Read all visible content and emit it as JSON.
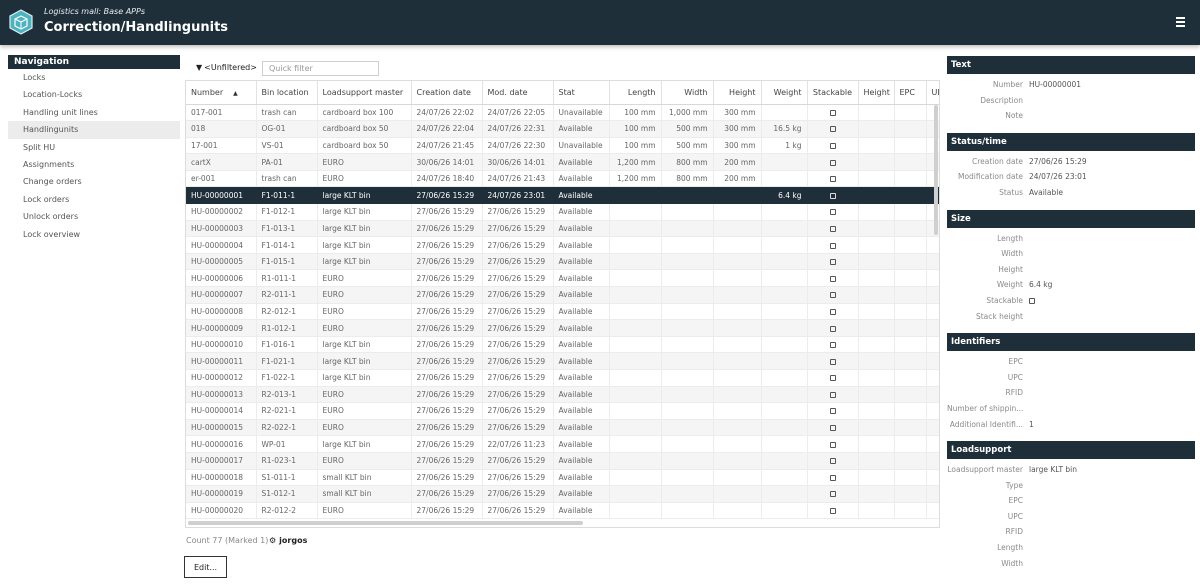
{
  "header": {
    "subtitle": "Logistics mall: Base APPs",
    "title": "Correction/Handlingunits"
  },
  "navigation": {
    "title": "Navigation",
    "items": [
      {
        "label": "Locks"
      },
      {
        "label": "Location-Locks"
      },
      {
        "label": "Handling unit lines"
      },
      {
        "label": "Handlingunits"
      },
      {
        "label": "Split HU"
      },
      {
        "label": "Assignments"
      },
      {
        "label": "Change orders"
      },
      {
        "label": "Lock orders"
      },
      {
        "label": "Unlock orders"
      },
      {
        "label": "Lock overview"
      }
    ],
    "active_index": 3
  },
  "toolbar": {
    "filter_label": "<Unfiltered>",
    "quick_filter_placeholder": "Quick filter",
    "quick_filter_value": ""
  },
  "grid": {
    "columns": [
      "Number",
      "Bin location",
      "Loadsupport master",
      "Creation date",
      "Mod. date",
      "Stat",
      "Length",
      "Width",
      "Height",
      "Weight",
      "Stackable",
      "Height",
      "EPC",
      "UPC"
    ],
    "selected_row": 5,
    "rows": [
      [
        "017-001",
        "trash can",
        "cardboard box 100",
        "24/07/26 22:02",
        "24/07/26 22:05",
        "Unavailable",
        "100 mm",
        "1,000 mm",
        "300 mm",
        ""
      ],
      [
        "018",
        "OG-01",
        "cardboard box 50",
        "24/07/26 22:04",
        "24/07/26 22:31",
        "Available",
        "100 mm",
        "500 mm",
        "300 mm",
        "16.5 kg"
      ],
      [
        "17-001",
        "VS-01",
        "cardboard box 50",
        "24/07/26 21:45",
        "24/07/26 22:30",
        "Unavailable",
        "100 mm",
        "500 mm",
        "300 mm",
        "1 kg"
      ],
      [
        "cartX",
        "PA-01",
        "EURO",
        "30/06/26 14:01",
        "30/06/26 14:01",
        "Available",
        "1,200 mm",
        "800 mm",
        "200 mm",
        ""
      ],
      [
        "er-001",
        "trash can",
        "EURO",
        "24/07/26 18:40",
        "24/07/26 21:43",
        "Available",
        "1,200 mm",
        "800 mm",
        "200 mm",
        ""
      ],
      [
        "HU-00000001",
        "F1-011-1",
        "large KLT bin",
        "27/06/26 15:29",
        "24/07/26 23:01",
        "Available",
        "",
        "",
        "",
        "6.4 kg"
      ],
      [
        "HU-00000002",
        "F1-012-1",
        "large KLT bin",
        "27/06/26 15:29",
        "27/06/26 15:29",
        "Available",
        "",
        "",
        "",
        ""
      ],
      [
        "HU-00000003",
        "F1-013-1",
        "large KLT bin",
        "27/06/26 15:29",
        "27/06/26 15:29",
        "Available",
        "",
        "",
        "",
        ""
      ],
      [
        "HU-00000004",
        "F1-014-1",
        "large KLT bin",
        "27/06/26 15:29",
        "27/06/26 15:29",
        "Available",
        "",
        "",
        "",
        ""
      ],
      [
        "HU-00000005",
        "F1-015-1",
        "large KLT bin",
        "27/06/26 15:29",
        "27/06/26 15:29",
        "Available",
        "",
        "",
        "",
        ""
      ],
      [
        "HU-00000006",
        "R1-011-1",
        "EURO",
        "27/06/26 15:29",
        "27/06/26 15:29",
        "Available",
        "",
        "",
        "",
        ""
      ],
      [
        "HU-00000007",
        "R2-011-1",
        "EURO",
        "27/06/26 15:29",
        "27/06/26 15:29",
        "Available",
        "",
        "",
        "",
        ""
      ],
      [
        "HU-00000008",
        "R2-012-1",
        "EURO",
        "27/06/26 15:29",
        "27/06/26 15:29",
        "Available",
        "",
        "",
        "",
        ""
      ],
      [
        "HU-00000009",
        "R1-012-1",
        "EURO",
        "27/06/26 15:29",
        "27/06/26 15:29",
        "Available",
        "",
        "",
        "",
        ""
      ],
      [
        "HU-00000010",
        "F1-016-1",
        "large KLT bin",
        "27/06/26 15:29",
        "27/06/26 15:29",
        "Available",
        "",
        "",
        "",
        ""
      ],
      [
        "HU-00000011",
        "F1-021-1",
        "large KLT bin",
        "27/06/26 15:29",
        "27/06/26 15:29",
        "Available",
        "",
        "",
        "",
        ""
      ],
      [
        "HU-00000012",
        "F1-022-1",
        "large KLT bin",
        "27/06/26 15:29",
        "27/06/26 15:29",
        "Available",
        "",
        "",
        "",
        ""
      ],
      [
        "HU-00000013",
        "R2-013-1",
        "EURO",
        "27/06/26 15:29",
        "27/06/26 15:29",
        "Available",
        "",
        "",
        "",
        ""
      ],
      [
        "HU-00000014",
        "R2-021-1",
        "EURO",
        "27/06/26 15:29",
        "27/06/26 15:29",
        "Available",
        "",
        "",
        "",
        ""
      ],
      [
        "HU-00000015",
        "R2-022-1",
        "EURO",
        "27/06/26 15:29",
        "27/06/26 15:29",
        "Available",
        "",
        "",
        "",
        ""
      ],
      [
        "HU-00000016",
        "WP-01",
        "large KLT bin",
        "27/06/26 15:29",
        "22/07/26 11:23",
        "Available",
        "",
        "",
        "",
        ""
      ],
      [
        "HU-00000017",
        "R1-023-1",
        "EURO",
        "27/06/26 15:29",
        "27/06/26 15:29",
        "Available",
        "",
        "",
        "",
        ""
      ],
      [
        "HU-00000018",
        "S1-011-1",
        "small KLT bin",
        "27/06/26 15:29",
        "27/06/26 15:29",
        "Available",
        "",
        "",
        "",
        ""
      ],
      [
        "HU-00000019",
        "S1-012-1",
        "small KLT bin",
        "27/06/26 15:29",
        "27/06/26 15:29",
        "Available",
        "",
        "",
        "",
        ""
      ],
      [
        "HU-00000020",
        "R2-012-2",
        "EURO",
        "27/06/26 15:29",
        "27/06/26 15:29",
        "Available",
        "",
        "",
        "",
        ""
      ]
    ]
  },
  "footer": {
    "count": "Count 77 (Marked 1)",
    "user": "jorgos",
    "edit_label": "Edit..."
  },
  "detail": {
    "sections": [
      {
        "title": "Text",
        "fields": [
          {
            "label": "Number",
            "value": "HU-00000001"
          },
          {
            "label": "Description",
            "value": ""
          },
          {
            "label": "Note",
            "value": ""
          }
        ]
      },
      {
        "title": "Status/time",
        "fields": [
          {
            "label": "Creation date",
            "value": "27/06/26 15:29"
          },
          {
            "label": "Modification date",
            "value": "24/07/26 23:01"
          },
          {
            "label": "Status",
            "value": "Available"
          }
        ]
      },
      {
        "title": "Size",
        "fields": [
          {
            "label": "Length",
            "value": ""
          },
          {
            "label": "Width",
            "value": ""
          },
          {
            "label": "Height",
            "value": ""
          },
          {
            "label": "Weight",
            "value": "6.4 kg"
          },
          {
            "label": "Stackable",
            "value": "",
            "checkbox": true
          },
          {
            "label": "Stack height",
            "value": ""
          }
        ]
      },
      {
        "title": "Identifiers",
        "fields": [
          {
            "label": "EPC",
            "value": ""
          },
          {
            "label": "UPC",
            "value": ""
          },
          {
            "label": "RFID",
            "value": ""
          },
          {
            "label": "Number of shippin...",
            "value": ""
          },
          {
            "label": "Additional Identifi...",
            "value": "1"
          }
        ]
      },
      {
        "title": "Loadsupport",
        "fields": [
          {
            "label": "Loadsupport master",
            "value": "large KLT bin"
          },
          {
            "label": "Type",
            "value": ""
          },
          {
            "label": "EPC",
            "value": ""
          },
          {
            "label": "UPC",
            "value": ""
          },
          {
            "label": "RFID",
            "value": ""
          },
          {
            "label": "Length",
            "value": ""
          },
          {
            "label": "Width",
            "value": ""
          }
        ]
      }
    ]
  },
  "icons": {
    "logo": "hexagon-box-logo-icon",
    "menu": "hamburger-menu-icon",
    "filter": "funnel-filter-icon",
    "sort": "sort-ascending-icon",
    "user": "gear-icon"
  },
  "colors": {
    "header_bg": "#1f2f3a",
    "selected_row_bg": "#1f2f3a",
    "logo_teal": "#4fb3bf"
  }
}
